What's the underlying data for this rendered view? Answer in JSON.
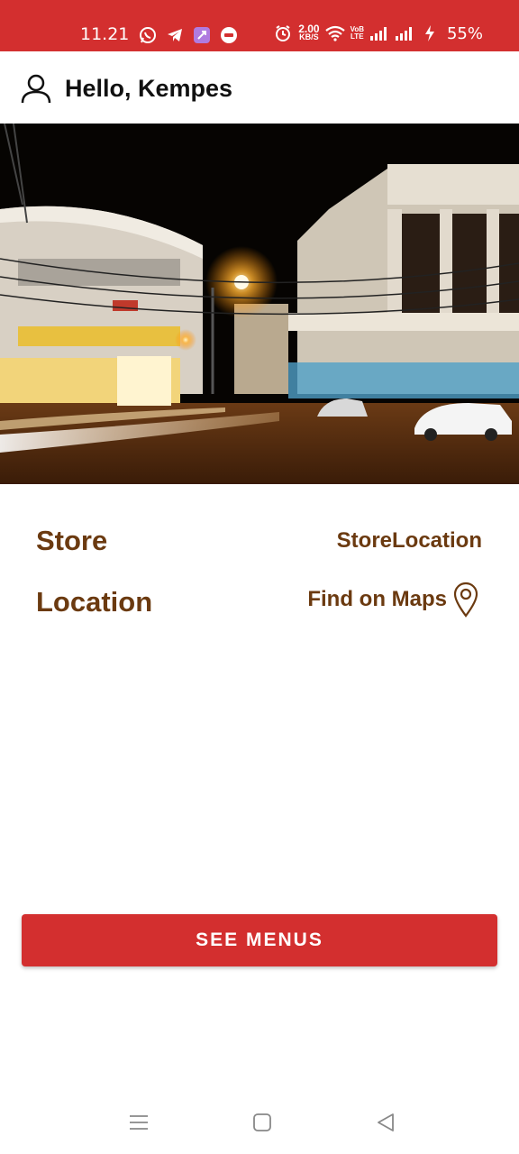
{
  "status_bar": {
    "time": "11.21",
    "speed_value": "2.00",
    "speed_unit": "KB/S",
    "vo_top": "VoB",
    "vo_bottom": "LTE",
    "battery": "55%",
    "icons": [
      "whatsapp-icon",
      "telegram-icon",
      "shortcut-app-icon",
      "message-app-icon",
      "alarm-icon",
      "wifi-icon",
      "signal-icon",
      "signal-icon",
      "charging-icon"
    ]
  },
  "header": {
    "greeting": "Hello, Kempes",
    "icon": "user-icon"
  },
  "banner": {
    "icon": "street-night-photo"
  },
  "info": {
    "store_label": "Store",
    "store_value": "StoreLocation",
    "location_label": "Location",
    "location_link": "Find on Maps",
    "location_icon": "map-pin-icon"
  },
  "actions": {
    "see_menus": "SEE MENUS"
  },
  "colors": {
    "accent": "#d32f2f",
    "brown": "#6b3a10"
  }
}
